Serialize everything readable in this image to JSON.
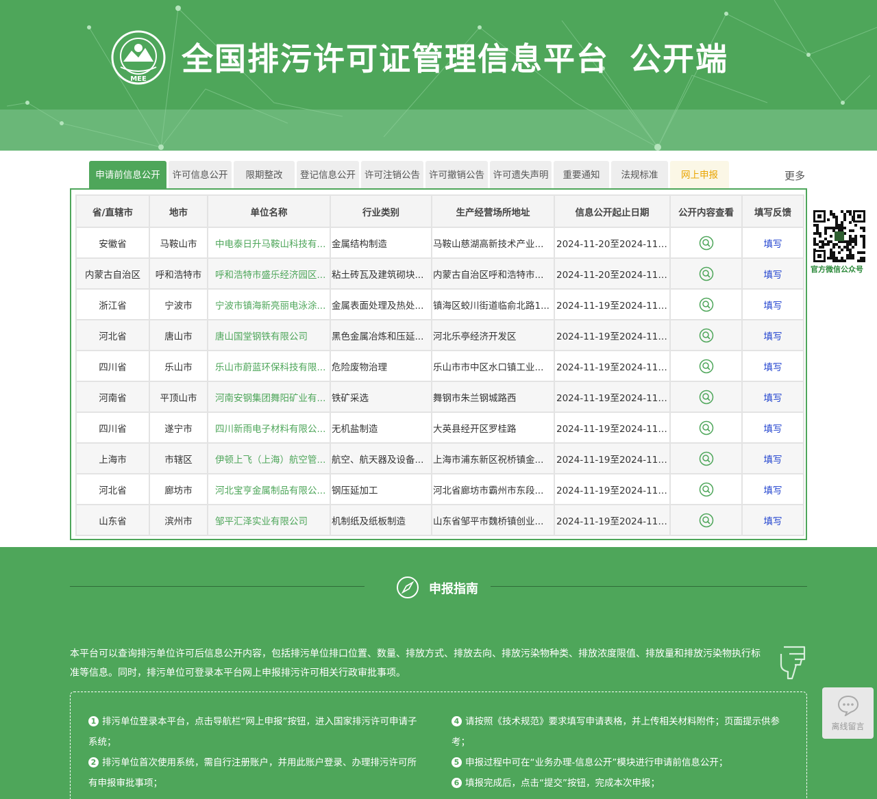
{
  "header": {
    "logo_text": "MEE",
    "title": "全国排污许可证管理信息平台",
    "title_suffix": "公开端",
    "theme_color": "#4ea65a"
  },
  "tabs": [
    {
      "label": "申请前信息公开",
      "active": true
    },
    {
      "label": "许可信息公开"
    },
    {
      "label": "限期整改"
    },
    {
      "label": "登记信息公开"
    },
    {
      "label": "许可注销公告"
    },
    {
      "label": "许可撤销公告"
    },
    {
      "label": "许可遗失声明"
    },
    {
      "label": "重要通知"
    },
    {
      "label": "法规标准"
    },
    {
      "label": "网上申报",
      "highlight": true
    }
  ],
  "more_label": "更多",
  "table": {
    "headers": [
      "省/直辖市",
      "地市",
      "单位名称",
      "行业类别",
      "生产经营场所地址",
      "信息公开起止日期",
      "公开内容查看",
      "填写反馈"
    ],
    "rows": [
      {
        "province": "安徽省",
        "city": "马鞍山市",
        "unit": "中电泰日升马鞍山科技有...",
        "industry": "金属结构制造",
        "address": "马鞍山慈湖高新技术产业...",
        "date": "2024-11-20至2024-11-...",
        "feedback": "填写"
      },
      {
        "province": "内蒙古自治区",
        "city": "呼和浩特市",
        "unit": "呼和浩特市盛乐经济园区...",
        "industry": "粘土砖瓦及建筑砌块...",
        "address": "内蒙古自治区呼和浩特市...",
        "date": "2024-11-20至2024-11-...",
        "feedback": "填写"
      },
      {
        "province": "浙江省",
        "city": "宁波市",
        "unit": "宁波市镇海新亮丽电泳涂...",
        "industry": "金属表面处理及热处...",
        "address": "镇海区蛟川街道临俞北路1...",
        "date": "2024-11-19至2024-11-...",
        "feedback": "填写"
      },
      {
        "province": "河北省",
        "city": "唐山市",
        "unit": "唐山国堂钢铁有限公司",
        "industry": "黑色金属冶炼和压延...",
        "address": "河北乐亭经济开发区",
        "date": "2024-11-19至2024-11-...",
        "feedback": "填写"
      },
      {
        "province": "四川省",
        "city": "乐山市",
        "unit": "乐山市蔚蓝环保科技有限...",
        "industry": "危险废物治理",
        "address": "乐山市市中区水口镇工业...",
        "date": "2024-11-19至2024-11-...",
        "feedback": "填写"
      },
      {
        "province": "河南省",
        "city": "平顶山市",
        "unit": "河南安钢集团舞阳矿业有...",
        "industry": "铁矿采选",
        "address": "舞钢市朱兰钢城路西",
        "date": "2024-11-19至2024-11-...",
        "feedback": "填写"
      },
      {
        "province": "四川省",
        "city": "遂宁市",
        "unit": "四川新雨电子材料有限公...",
        "industry": "无机盐制造",
        "address": "大英县经开区罗桂路",
        "date": "2024-11-19至2024-11-...",
        "feedback": "填写"
      },
      {
        "province": "上海市",
        "city": "市辖区",
        "unit": "伊顿上飞（上海）航空管...",
        "industry": "航空、航天器及设备...",
        "address": "上海市浦东新区祝桥镇金...",
        "date": "2024-11-19至2024-11-...",
        "feedback": "填写"
      },
      {
        "province": "河北省",
        "city": "廊坊市",
        "unit": "河北宝亨金属制品有限公...",
        "industry": "钢压延加工",
        "address": "河北省廊坊市霸州市东段...",
        "date": "2024-11-19至2024-11-...",
        "feedback": "填写"
      },
      {
        "province": "山东省",
        "city": "滨州市",
        "unit": "邹平汇泽实业有限公司",
        "industry": "机制纸及纸板制造",
        "address": "山东省邹平市魏桥镇创业...",
        "date": "2024-11-19至2024-11-...",
        "feedback": "填写"
      }
    ]
  },
  "qr": {
    "label": "官方微信公众号"
  },
  "guide": {
    "title": "申报指南",
    "description": "本平台可以查询排污单位许可后信息公开内容，包括排污单位排口位置、数量、排放方式、排放去向、排放污染物种类、排放浓度限值、排放量和排放污染物执行标准等信息。同时，排污单位可登录本平台网上申报排污许可相关行政审批事项。",
    "steps_left": [
      {
        "num": "1",
        "text": "排污单位登录本平台，点击导航栏“网上申报”按钮，进入国家排污许可申请子系统；"
      },
      {
        "num": "2",
        "text": "排污单位首次使用系统，需自行注册账户，并用此账户登录、办理排污许可所有申报审批事项；"
      }
    ],
    "steps_right": [
      {
        "num": "4",
        "text": "请按照《技术规范》要求填写申请表格，并上传相关材料附件；页面提示供参考；"
      },
      {
        "num": "5",
        "text": "申报过程中可在“业务办理-信息公开”模块进行申请前信息公开；"
      },
      {
        "num": "6",
        "text": "填报完成后，点击“提交”按钮，完成本次申报；"
      }
    ]
  },
  "float_message": {
    "label": "离线留言"
  }
}
